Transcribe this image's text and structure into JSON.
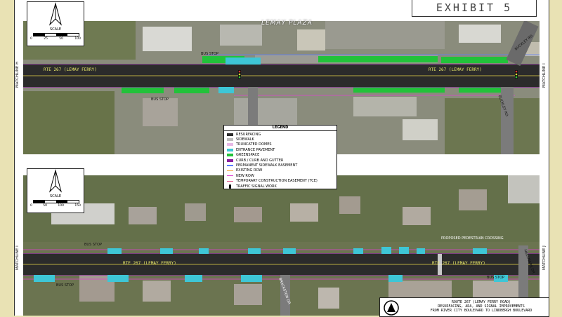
{
  "exhibit_title": "EXHIBIT 5",
  "plaza_label": "LEMAY PLAZA",
  "scale": {
    "label": "SCALE",
    "ticks_top": [
      "0",
      "25",
      "50",
      "100"
    ],
    "ticks_bottom": [
      "0",
      "50",
      "100",
      "150"
    ]
  },
  "matchlines": {
    "top_left": "MATCHLINE H",
    "top_right": "MATCHLINE I",
    "bottom_left": "MATCHLINE I",
    "bottom_right": "MATCHLINE J"
  },
  "road_labels": {
    "top": "RTE 267 (LEMAY FERRY)",
    "top_right": "RTE 267 (LEMAY FERRY)",
    "bottom_left": "RTE 267 (LEMAY FERRY)",
    "bottom_right": "RTE 267 (LEMAY FERRY)"
  },
  "annotations": {
    "bus_stop_1": "BUS STOP",
    "bus_stop_2": "BUS STOP",
    "bus_stop_3": "BUS STOP",
    "bus_stop_4": "BUS STOP",
    "bus_stop_5": "BUS STOP",
    "crossing": "PROPOSED PEDESTRIAN CROSSING",
    "street_1": "BUCKLEY RD",
    "street_2": "BUCKLEY RD",
    "street_3": "BRACKSTON DR",
    "street_4": "HEELMARK DR"
  },
  "legend": {
    "title": "LEGEND",
    "items": [
      {
        "label": "RESURFACING",
        "color": "#2b2b2b",
        "kind": "fill"
      },
      {
        "label": "SIDEWALK",
        "color": "#bdbdbd",
        "kind": "fill"
      },
      {
        "label": "TRUNCATED DOMES",
        "color": "#e6b8e6",
        "kind": "fill"
      },
      {
        "label": "ENTRANCE PAVEMENT",
        "color": "#3ec6d6",
        "kind": "fill"
      },
      {
        "label": "GREENSPACE",
        "color": "#22c23a",
        "kind": "fill"
      },
      {
        "label": "CURB / CURB AND GUTTER",
        "color": "#8a1fa0",
        "kind": "fill"
      },
      {
        "label": "PERMANENT SIDEWALK EASEMENT",
        "color": "#5a7cff",
        "kind": "line"
      },
      {
        "label": "EXISTING ROW",
        "color": "#f2a33a",
        "kind": "line"
      },
      {
        "label": "NEW ROW",
        "color": "#e040d0",
        "kind": "line"
      },
      {
        "label": "TEMPORARY CONSTRUCTION EASEMENT (TCE)",
        "color": "#e05a8a",
        "kind": "line"
      },
      {
        "label": "TRAFFIC SIGNAL WORK",
        "color": "#111111",
        "kind": "signal"
      }
    ]
  },
  "title_block": {
    "line1": "ROUTE 267 (LEMAY FERRY ROAD)",
    "line2": "RESURFACING, ADA, AND SIGNAL IMPROVEMENTS",
    "line3": "FROM RIVER CITY BOULEVARD TO LINDBERGH BOULEVARD"
  }
}
